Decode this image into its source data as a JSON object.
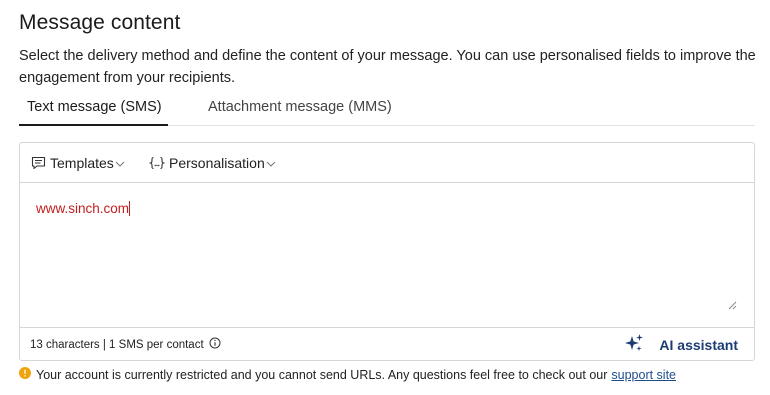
{
  "header": {
    "title": "Message content",
    "description": "Select the delivery method and define the content of your message. You can use personalised fields to improve the engagement from your recipients."
  },
  "tabs": [
    {
      "label": "Text message (SMS)",
      "active": true
    },
    {
      "label": "Attachment message (MMS)",
      "active": false
    }
  ],
  "toolbar": {
    "templates_label": "Templates",
    "templates_icon": "message-icon",
    "personalisation_label": "Personalisation",
    "personalisation_icon": "braces-icon"
  },
  "editor": {
    "value": "www.sinch.com",
    "text_color": "#c41e1e"
  },
  "footer": {
    "count_text": "13 characters | 1 SMS per contact",
    "ai_label": "AI assistant",
    "ai_color": "#1b3d73"
  },
  "notice": {
    "icon": "warning-icon",
    "icon_color": "#f0a30a",
    "text": "Your account is currently restricted and you cannot send URLs. Any questions feel free to check out our",
    "link_label": "support site"
  }
}
